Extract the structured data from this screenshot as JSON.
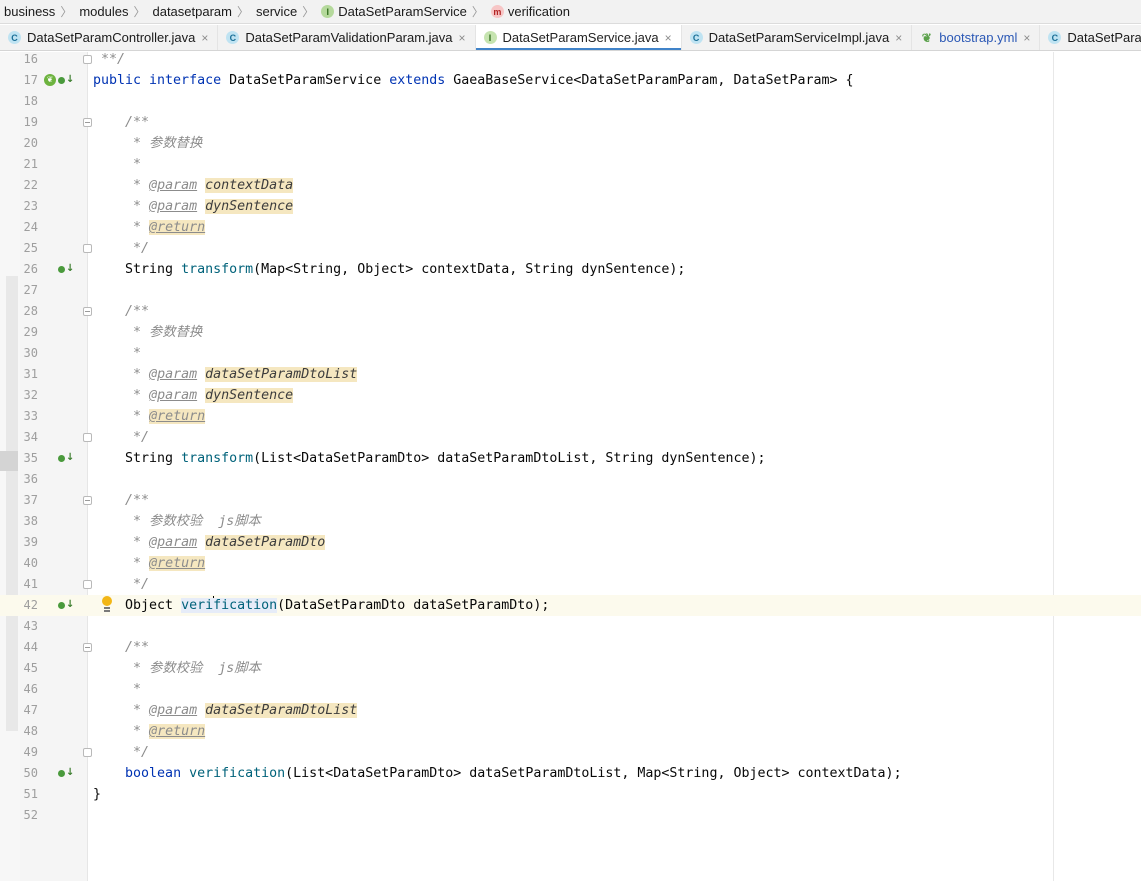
{
  "breadcrumb": [
    {
      "label": "business",
      "icon": null
    },
    {
      "label": "modules",
      "icon": null
    },
    {
      "label": "datasetparam",
      "icon": null
    },
    {
      "label": "service",
      "icon": null
    },
    {
      "label": "DataSetParamService",
      "icon": "interface-icon",
      "glyph": "I"
    },
    {
      "label": "verification",
      "icon": "method-icon",
      "glyph": "m"
    }
  ],
  "tabs": [
    {
      "label": "DataSetParamController.java",
      "icon": "class-icon",
      "glyph": "C",
      "kind": "c",
      "active": false,
      "closable": true
    },
    {
      "label": "DataSetParamValidationParam.java",
      "icon": "class-icon",
      "glyph": "C",
      "kind": "c",
      "active": false,
      "closable": true
    },
    {
      "label": "DataSetParamService.java",
      "icon": "interface-icon",
      "glyph": "I",
      "kind": "i",
      "active": true,
      "closable": true
    },
    {
      "label": "DataSetParamServiceImpl.java",
      "icon": "class-icon",
      "glyph": "C",
      "kind": "c",
      "active": false,
      "closable": true
    },
    {
      "label": "bootstrap.yml",
      "icon": "spring-yml-icon",
      "glyph": "❦",
      "kind": "y",
      "active": false,
      "closable": true
    },
    {
      "label": "DataSetPara",
      "icon": "class-icon",
      "glyph": "C",
      "kind": "c",
      "active": false,
      "closable": false
    }
  ],
  "editor": {
    "current_line": 42,
    "lines": [
      {
        "n": 16,
        "tokens": [
          [
            "cmt",
            " **/"
          ]
        ],
        "fold": "end"
      },
      {
        "n": 17,
        "tokens": [
          [
            "kw",
            "public interface "
          ],
          [
            "",
            "DataSetParamService "
          ],
          [
            "kw",
            "extends "
          ],
          [
            "",
            "GaeaBaseService<DataSetParamParam, DataSetParam> {"
          ]
        ],
        "marker": "spring-impl"
      },
      {
        "n": 18,
        "tokens": []
      },
      {
        "n": 19,
        "tokens": [
          [
            "",
            "    "
          ],
          [
            "cmt",
            "/**"
          ]
        ],
        "fold": "open"
      },
      {
        "n": 20,
        "tokens": [
          [
            "",
            "    "
          ],
          [
            "cmt",
            " * 参数替换"
          ]
        ]
      },
      {
        "n": 21,
        "tokens": [
          [
            "",
            "    "
          ],
          [
            "cmt",
            " *"
          ]
        ]
      },
      {
        "n": 22,
        "tokens": [
          [
            "",
            "    "
          ],
          [
            "cmt",
            " * "
          ],
          [
            "tag",
            "@param"
          ],
          [
            "cmt",
            " "
          ],
          [
            "pv",
            "contextData"
          ]
        ]
      },
      {
        "n": 23,
        "tokens": [
          [
            "",
            "    "
          ],
          [
            "cmt",
            " * "
          ],
          [
            "tag",
            "@param"
          ],
          [
            "cmt",
            " "
          ],
          [
            "pv",
            "dynSentence"
          ]
        ]
      },
      {
        "n": 24,
        "tokens": [
          [
            "",
            "    "
          ],
          [
            "cmt",
            " * "
          ],
          [
            "tagret",
            "@return"
          ]
        ]
      },
      {
        "n": 25,
        "tokens": [
          [
            "",
            "    "
          ],
          [
            "cmt",
            " */"
          ]
        ],
        "fold": "end"
      },
      {
        "n": 26,
        "tokens": [
          [
            "",
            "    String "
          ],
          [
            "fn",
            "transform"
          ],
          [
            "",
            "(Map<String, Object> contextData, String dynSentence);"
          ]
        ],
        "marker": "impl"
      },
      {
        "n": 27,
        "tokens": []
      },
      {
        "n": 28,
        "tokens": [
          [
            "",
            "    "
          ],
          [
            "cmt",
            "/**"
          ]
        ],
        "fold": "open"
      },
      {
        "n": 29,
        "tokens": [
          [
            "",
            "    "
          ],
          [
            "cmt",
            " * 参数替换"
          ]
        ]
      },
      {
        "n": 30,
        "tokens": [
          [
            "",
            "    "
          ],
          [
            "cmt",
            " *"
          ]
        ]
      },
      {
        "n": 31,
        "tokens": [
          [
            "",
            "    "
          ],
          [
            "cmt",
            " * "
          ],
          [
            "tag",
            "@param"
          ],
          [
            "cmt",
            " "
          ],
          [
            "pv",
            "dataSetParamDtoList"
          ]
        ]
      },
      {
        "n": 32,
        "tokens": [
          [
            "",
            "    "
          ],
          [
            "cmt",
            " * "
          ],
          [
            "tag",
            "@param"
          ],
          [
            "cmt",
            " "
          ],
          [
            "pv",
            "dynSentence"
          ]
        ]
      },
      {
        "n": 33,
        "tokens": [
          [
            "",
            "    "
          ],
          [
            "cmt",
            " * "
          ],
          [
            "tagret",
            "@return"
          ]
        ]
      },
      {
        "n": 34,
        "tokens": [
          [
            "",
            "    "
          ],
          [
            "cmt",
            " */"
          ]
        ],
        "fold": "end"
      },
      {
        "n": 35,
        "tokens": [
          [
            "",
            "    String "
          ],
          [
            "fn",
            "transform"
          ],
          [
            "",
            "(List<DataSetParamDto> dataSetParamDtoList, String dynSentence);"
          ]
        ],
        "marker": "impl"
      },
      {
        "n": 36,
        "tokens": []
      },
      {
        "n": 37,
        "tokens": [
          [
            "",
            "    "
          ],
          [
            "cmt",
            "/**"
          ]
        ],
        "fold": "open"
      },
      {
        "n": 38,
        "tokens": [
          [
            "",
            "    "
          ],
          [
            "cmt",
            " * 参数校验  js脚本"
          ]
        ]
      },
      {
        "n": 39,
        "tokens": [
          [
            "",
            "    "
          ],
          [
            "cmt",
            " * "
          ],
          [
            "tag",
            "@param"
          ],
          [
            "cmt",
            " "
          ],
          [
            "pv",
            "dataSetParamDto"
          ]
        ]
      },
      {
        "n": 40,
        "tokens": [
          [
            "",
            "    "
          ],
          [
            "cmt",
            " * "
          ],
          [
            "tagret",
            "@return"
          ]
        ]
      },
      {
        "n": 41,
        "tokens": [
          [
            "",
            "    "
          ],
          [
            "cmt",
            " */"
          ]
        ],
        "fold": "end"
      },
      {
        "n": 42,
        "tokens": [
          [
            "",
            "    Object "
          ],
          [
            "fnhl",
            "veri"
          ],
          [
            "caret",
            ""
          ],
          [
            "fnhl",
            "fication"
          ],
          [
            "",
            "(DataSetParamDto dataSetParamDto);"
          ]
        ],
        "marker": "impl",
        "bulb": true
      },
      {
        "n": 43,
        "tokens": []
      },
      {
        "n": 44,
        "tokens": [
          [
            "",
            "    "
          ],
          [
            "cmt",
            "/**"
          ]
        ],
        "fold": "open"
      },
      {
        "n": 45,
        "tokens": [
          [
            "",
            "    "
          ],
          [
            "cmt",
            " * 参数校验  js脚本"
          ]
        ]
      },
      {
        "n": 46,
        "tokens": [
          [
            "",
            "    "
          ],
          [
            "cmt",
            " *"
          ]
        ]
      },
      {
        "n": 47,
        "tokens": [
          [
            "",
            "    "
          ],
          [
            "cmt",
            " * "
          ],
          [
            "tag",
            "@param"
          ],
          [
            "cmt",
            " "
          ],
          [
            "pv",
            "dataSetParamDtoList"
          ]
        ]
      },
      {
        "n": 48,
        "tokens": [
          [
            "",
            "    "
          ],
          [
            "cmt",
            " * "
          ],
          [
            "tagret",
            "@return"
          ]
        ]
      },
      {
        "n": 49,
        "tokens": [
          [
            "",
            "    "
          ],
          [
            "cmt",
            " */"
          ]
        ],
        "fold": "end"
      },
      {
        "n": 50,
        "tokens": [
          [
            "",
            "    "
          ],
          [
            "kw",
            "boolean "
          ],
          [
            "fn",
            "verification"
          ],
          [
            "",
            "(List<DataSetParamDto> dataSetParamDtoList, Map<String, Object> contextData);"
          ]
        ],
        "marker": "impl"
      },
      {
        "n": 51,
        "tokens": [
          [
            "",
            "}"
          ]
        ]
      },
      {
        "n": 52,
        "tokens": []
      }
    ]
  },
  "colors": {
    "keyword": "#0033b3",
    "method": "#00627a",
    "comment": "#8c8c8c",
    "param_highlight": "#f5e7c0",
    "tab_active_underline": "#4083c9",
    "current_line": "#fcfaed"
  }
}
